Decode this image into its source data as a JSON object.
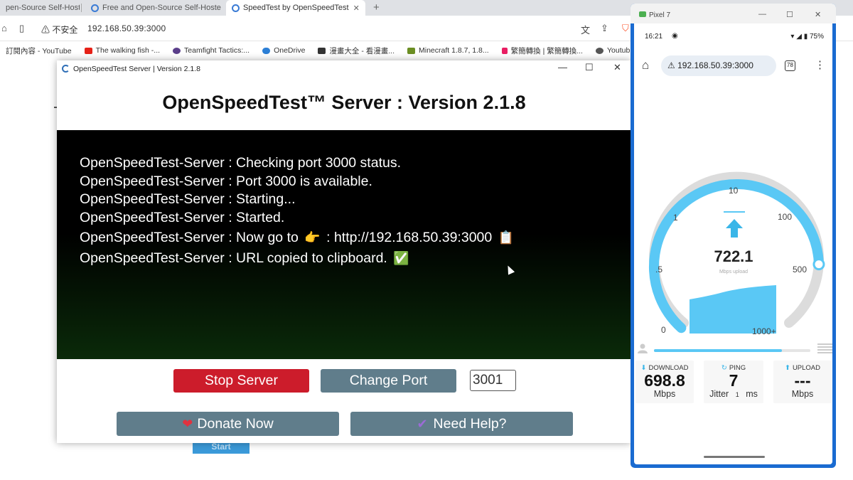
{
  "browser": {
    "tabs": [
      {
        "label": "pen-Source Self-Hoste"
      },
      {
        "label": "Free and Open-Source Self-Hoste"
      },
      {
        "label": "SpeedTest by OpenSpeedTest"
      }
    ],
    "new_tab": "+",
    "security_label": "不安全",
    "url": "192.168.50.39:3000",
    "bookmarks": [
      {
        "label": "訂閱內容 - YouTube",
        "color": "#e62117"
      },
      {
        "label": "The walking fish -...",
        "color": "#e62117"
      },
      {
        "label": "Teamfight Tactics:...",
        "color": "#5a3e8a"
      },
      {
        "label": "OneDrive",
        "color": "#2c7fd6"
      },
      {
        "label": "漫畫大全 - 看漫畫...",
        "color": "#333333"
      },
      {
        "label": "Minecraft 1.8.7, 1.8...",
        "color": "#6b8e23"
      },
      {
        "label": "繁簡轉換 | 繁簡轉換...",
        "color": "#e91e63"
      },
      {
        "label": "Youtub",
        "color": "#555555"
      }
    ]
  },
  "background_page": {
    "button_label": "Start"
  },
  "app": {
    "window_title": "OpenSpeedTest Server | Version 2.1.8",
    "heading": "OpenSpeedTest™ Server : Version 2.1.8",
    "console_lines": [
      {
        "text": "OpenSpeedTest-Server : Checking port 3000 status.",
        "emoji": ""
      },
      {
        "text": "OpenSpeedTest-Server : Port 3000 is available.",
        "emoji": ""
      },
      {
        "text": "OpenSpeedTest-Server : Starting...",
        "emoji": ""
      },
      {
        "text": "OpenSpeedTest-Server : Started.",
        "emoji": ""
      },
      {
        "text": "OpenSpeedTest-Server : Now go to",
        "emoji": "👉",
        "text2": ": http://192.168.50.39:3000",
        "emoji2": "📋"
      },
      {
        "text": "OpenSpeedTest-Server : URL copied to clipboard.",
        "emoji": "✅"
      }
    ],
    "stop_button": "Stop Server",
    "change_port_button": "Change Port",
    "port_value": "3001",
    "donate_button": "Donate Now",
    "help_button": "Need Help?",
    "colors": {
      "stop": "#cc1c2b",
      "secondary": "#607d8b",
      "console_bg": "#000000"
    }
  },
  "emulator": {
    "device_name": "Pixel 7",
    "status": {
      "time": "16:21",
      "battery": "75%"
    },
    "url": "192.168.50.39:3000",
    "tab_count": "78",
    "gauge": {
      "tick_labels": [
        "0",
        ".5",
        "1",
        "10",
        "100",
        "500",
        "1000+"
      ],
      "value": "722.1",
      "value_label": "Mbps upload",
      "progress_fraction": 0.82
    },
    "download": {
      "label": "DOWNLOAD",
      "value": "698.8",
      "unit": "Mbps"
    },
    "ping": {
      "label": "PING",
      "value": "7",
      "jitter_label": "Jitter",
      "jitter_value": "1",
      "jitter_unit": "ms"
    },
    "upload": {
      "label": "UPLOAD",
      "value": "---",
      "unit": "Mbps"
    },
    "accent": "#5ac8f5"
  }
}
